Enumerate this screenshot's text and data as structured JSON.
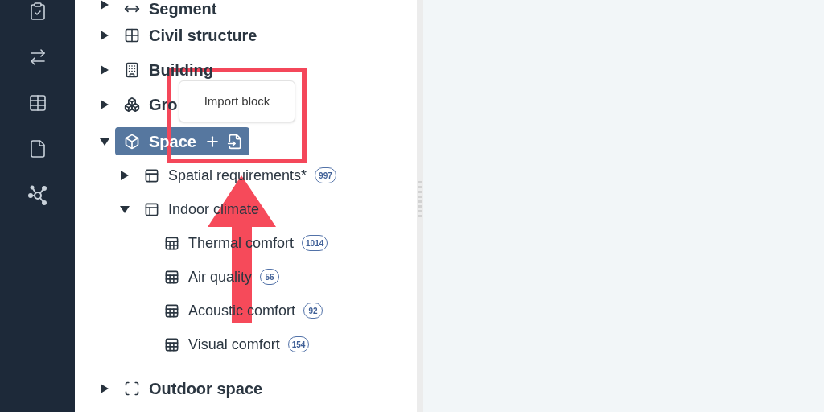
{
  "tree": [
    {
      "label": "Segment",
      "kind": "segment",
      "expanded": false,
      "selected": false
    },
    {
      "label": "Civil structure",
      "kind": "grid",
      "expanded": false,
      "selected": false
    },
    {
      "label": "Building",
      "kind": "building",
      "expanded": false,
      "selected": false
    },
    {
      "label": "Gro",
      "kind": "group",
      "expanded": false,
      "selected": false
    },
    {
      "label": "Space",
      "kind": "space",
      "expanded": true,
      "selected": true,
      "children": [
        {
          "label": "Spatial requirements*",
          "kind": "panel",
          "badge": "997",
          "expanded": false,
          "selected": false
        },
        {
          "label": "Indoor climate",
          "kind": "panel",
          "expanded": true,
          "selected": false,
          "children": [
            {
              "label": "Thermal comfort",
              "kind": "sheet",
              "badge": "1014",
              "selected": false
            },
            {
              "label": "Air quality",
              "kind": "sheet",
              "badge": "56",
              "selected": false
            },
            {
              "label": "Acoustic comfort",
              "kind": "sheet",
              "badge": "92",
              "selected": false
            },
            {
              "label": "Visual comfort",
              "kind": "sheet",
              "badge": "154",
              "selected": false
            }
          ]
        }
      ]
    },
    {
      "label": "Outdoor space",
      "kind": "outdoor",
      "expanded": false,
      "selected": false
    }
  ],
  "tooltip": {
    "text": "Import block"
  }
}
